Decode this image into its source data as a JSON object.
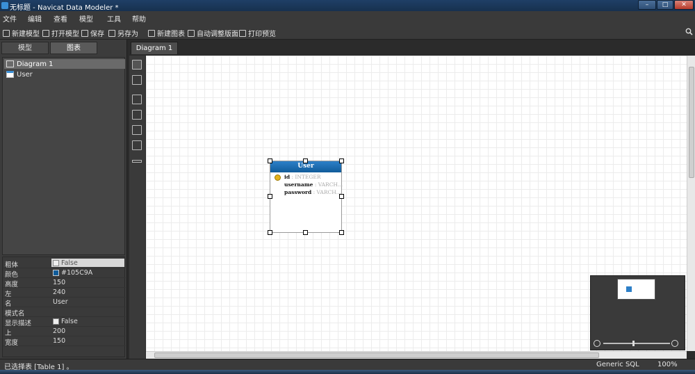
{
  "window": {
    "title": "无标题 - Navicat Data Modeler *",
    "controls": [
      "–",
      "□",
      "✕"
    ]
  },
  "menu": [
    "文件",
    "编辑",
    "查看",
    "模型",
    "工具",
    "帮助"
  ],
  "toolbar": {
    "new_model": "新建模型",
    "open_model": "打开模型",
    "save": "保存",
    "save_as": "另存为",
    "new_diagram": "新建图表",
    "auto_layout": "自动调整版面",
    "print_preview": "打印预览"
  },
  "left": {
    "tabs": [
      "模型",
      "图表"
    ],
    "tree": [
      "Diagram 1",
      "User"
    ],
    "props": [
      {
        "key": "粗体",
        "value": "False",
        "checkbox": true
      },
      {
        "key": "颜色",
        "value": "#105C9A",
        "swatch": "#105C9A"
      },
      {
        "key": "高度",
        "value": "150"
      },
      {
        "key": "左",
        "value": "240"
      },
      {
        "key": "名",
        "value": "User"
      },
      {
        "key": "模式名",
        "value": ""
      },
      {
        "key": "显示描述",
        "value": "False",
        "checkbox": true
      },
      {
        "key": "上",
        "value": "200"
      },
      {
        "key": "宽度",
        "value": "150"
      }
    ]
  },
  "doc_tab": "Diagram 1",
  "entity": {
    "name": "User",
    "header_color": "#105C9A",
    "fields": [
      {
        "name": "id",
        "type": ": INTEGER"
      },
      {
        "name": "username",
        "type": ": VARCH..."
      },
      {
        "name": "password",
        "type": ": VARCH..."
      }
    ]
  },
  "status": {
    "selection": "已选择表 [Table 1] 。",
    "db": "Generic SQL",
    "zoom": "100%"
  }
}
